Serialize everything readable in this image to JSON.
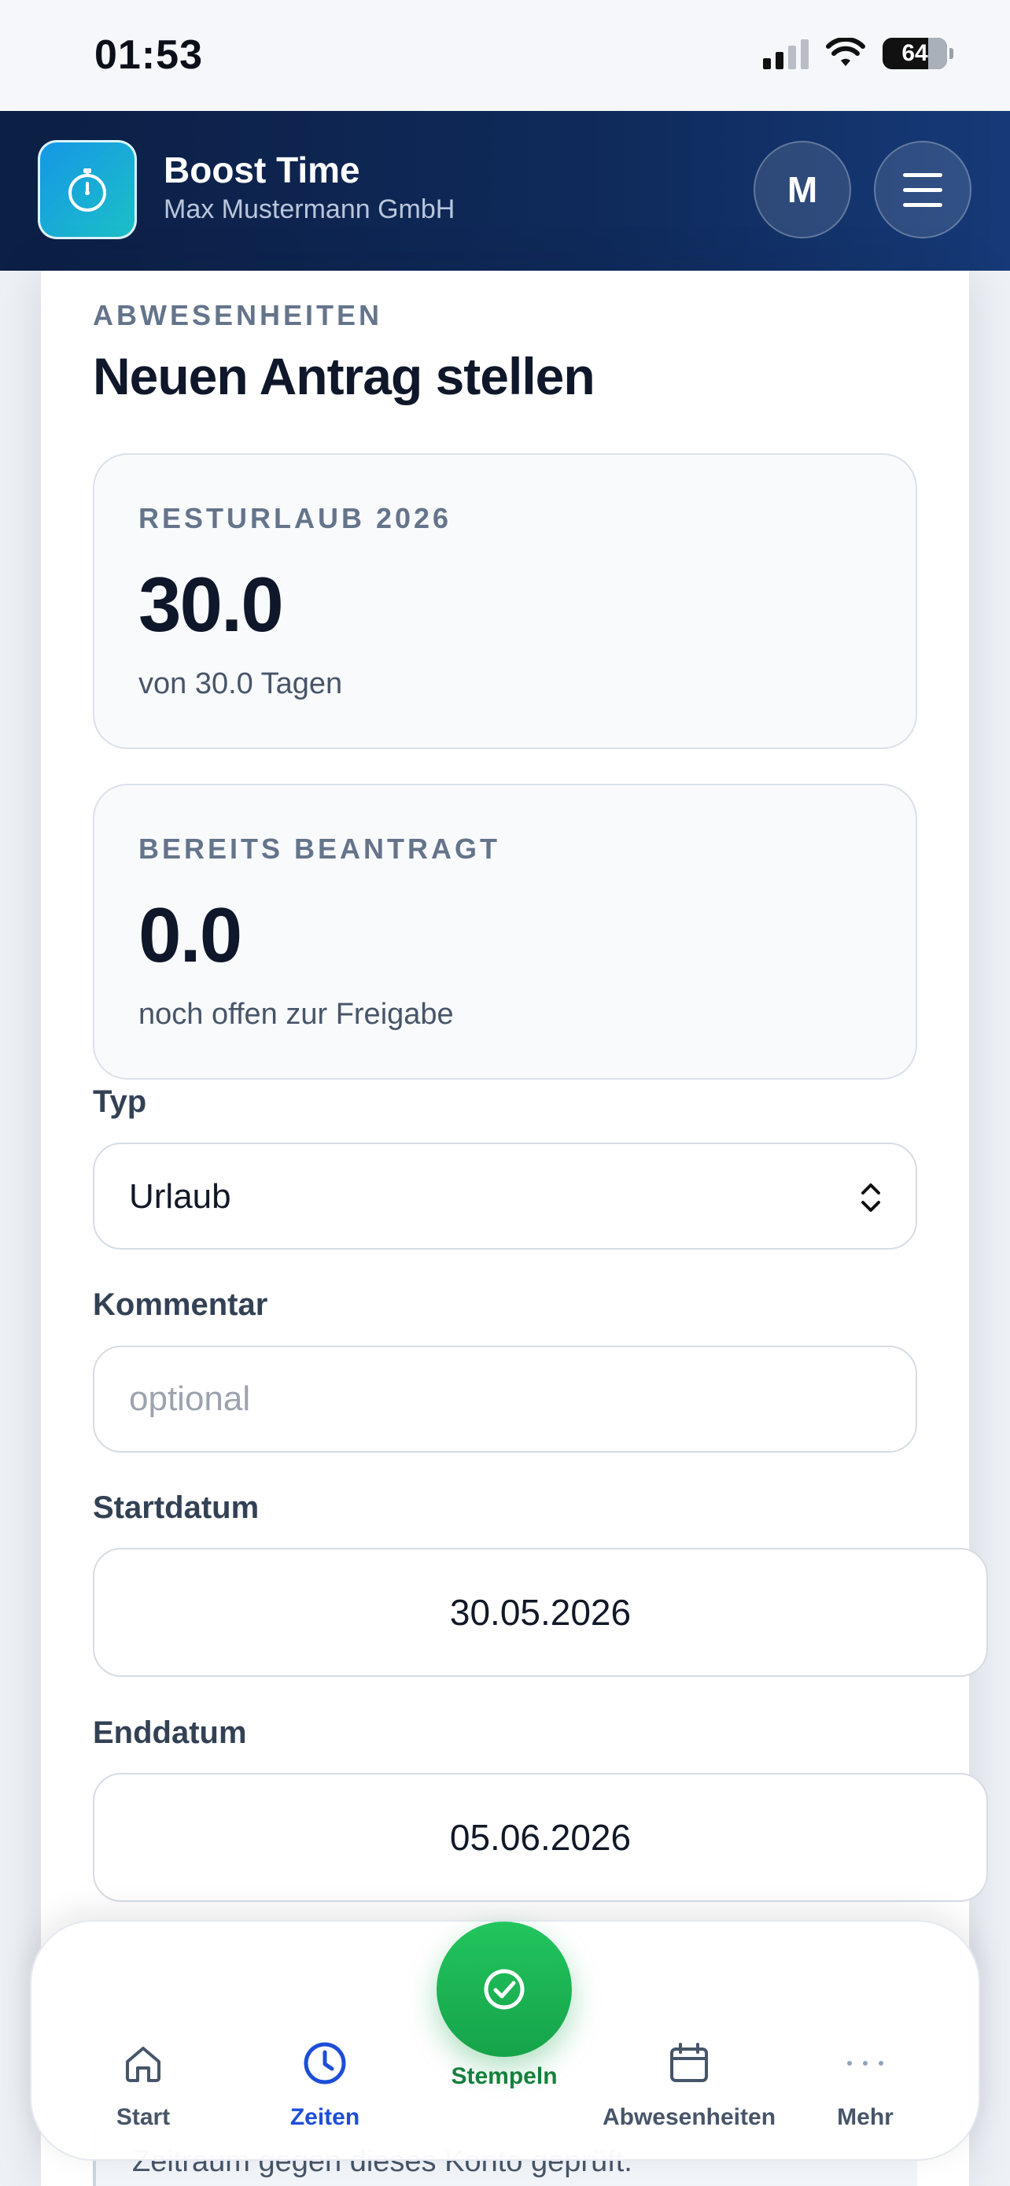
{
  "status_bar": {
    "time": "01:53",
    "battery": "64"
  },
  "header": {
    "app_name": "Boost Time",
    "company": "Max Mustermann GmbH",
    "avatar_initial": "M"
  },
  "page": {
    "eyebrow": "ABWESENHEITEN",
    "title": "Neuen Antrag stellen"
  },
  "stats": [
    {
      "label": "RESTURLAUB 2026",
      "value": "30.0",
      "note": "von 30.0 Tagen"
    },
    {
      "label": "BEREITS BEANTRAGT",
      "value": "0.0",
      "note": "noch offen zur Freigabe"
    }
  ],
  "form": {
    "type_label": "Typ",
    "type_value": "Urlaub",
    "comment_label": "Kommentar",
    "comment_placeholder": "optional",
    "start_label": "Startdatum",
    "start_value": "30.05.2026",
    "end_label": "Enddatum",
    "end_value": "05.06.2026",
    "partial_text": "Zeitraum gegen dieses Konto geprüft."
  },
  "bottom_nav": {
    "items": [
      {
        "label": "Start",
        "icon": "home-icon"
      },
      {
        "label": "Zeiten",
        "icon": "clock-icon",
        "active": true
      },
      {
        "label": "Abwesenheiten",
        "icon": "calendar-icon"
      },
      {
        "label": "Mehr",
        "icon": "more-icon"
      }
    ],
    "fab_label": "Stempeln",
    "fab_icon": "check-circle-icon"
  },
  "colors": {
    "header_bg": "#0f2a5b",
    "accent_blue": "#1d4ed8",
    "fab_green": "#16a34a"
  }
}
